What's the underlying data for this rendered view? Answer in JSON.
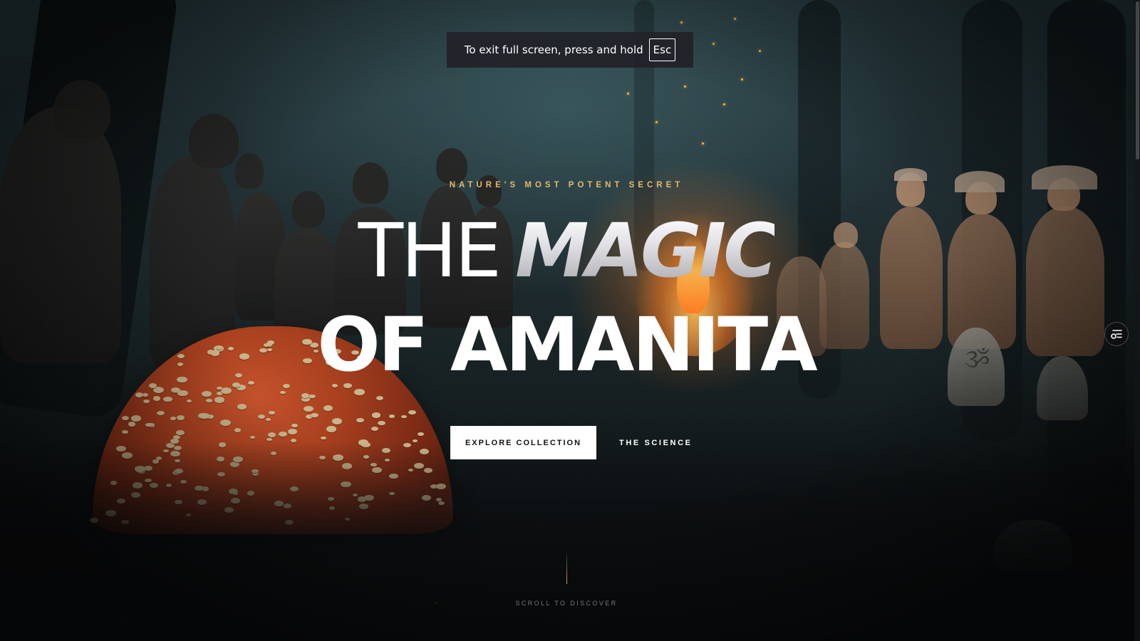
{
  "fullscreen_notice": {
    "text": "To exit full screen, press and hold",
    "key": "Esc"
  },
  "hero": {
    "kicker": "NATURE'S MOST POTENT SECRET",
    "title_the": "THE",
    "title_magic": "MAGIC",
    "title_line2": "OF AMANITA",
    "primary_button": "EXPLORE COLLECTION",
    "secondary_link": "THE SCIENCE",
    "scroll_label": "SCROLL TO DISCOVER"
  },
  "side_widget": {
    "icon": "filter-menu-icon"
  },
  "colors": {
    "accent_gold": "#e6b86a",
    "title_white": "#ffffff",
    "button_bg": "#ffffff",
    "button_text": "#111111",
    "mushroom_cap": "#b4462a"
  }
}
